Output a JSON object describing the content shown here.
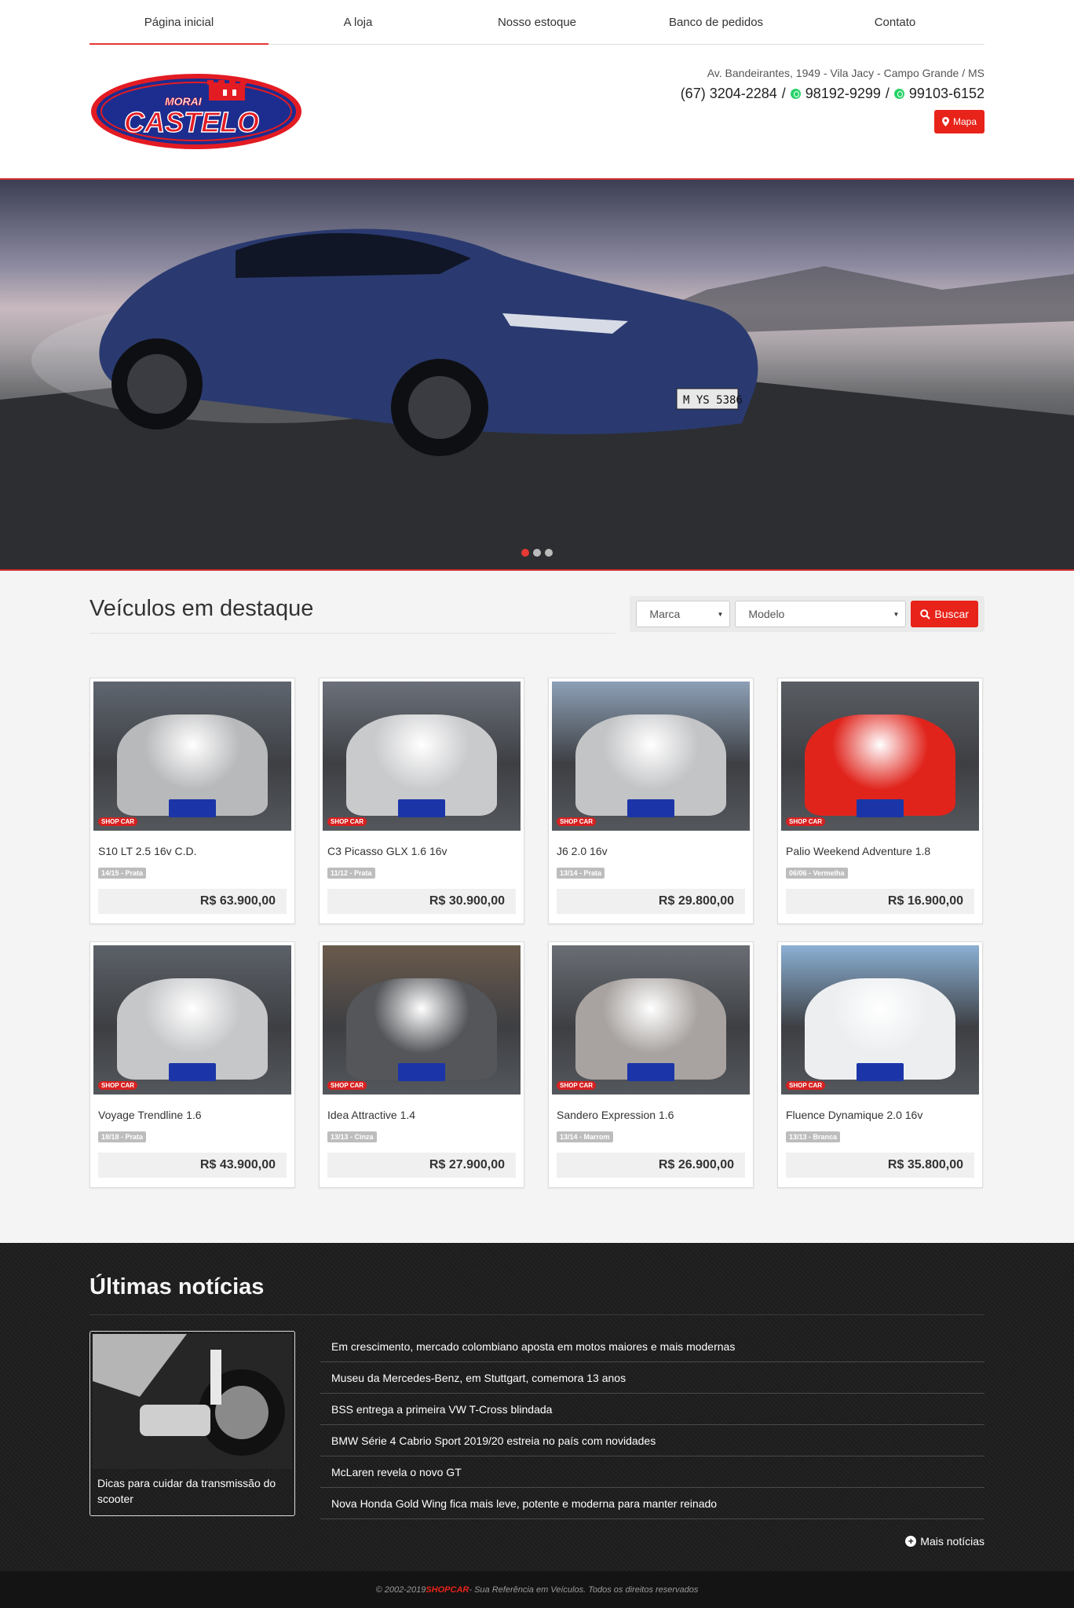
{
  "nav": {
    "items": [
      {
        "label": "Página inicial",
        "active": true
      },
      {
        "label": "A loja"
      },
      {
        "label": "Nosso estoque"
      },
      {
        "label": "Banco de pedidos"
      },
      {
        "label": "Contato"
      }
    ]
  },
  "header": {
    "logo_icon": "morai-castelo-logo",
    "logo_line1": "MORAI",
    "logo_line2": "CASTELO",
    "address": "Av. Bandeirantes, 1949 - Vila Jacy - Campo Grande / MS",
    "phone1": "(67) 3204-2284",
    "separator": "/",
    "phone2": "98192-9299",
    "phone3": "99103-6152",
    "map_label": "Mapa",
    "map_icon": "map-marker-icon",
    "whatsapp_icon": "whatsapp-icon"
  },
  "hero": {
    "plate": "M YS 5386",
    "slides_total": 3,
    "active_slide": 1
  },
  "featured": {
    "title": "Veículos em destaque",
    "marca_placeholder": "Marca",
    "modelo_placeholder": "Modelo",
    "search_label": "Buscar",
    "vehicles": [
      {
        "name": "S10 LT 2.5 16v C.D.",
        "tag": "14/15 - Prata",
        "price": "R$ 63.900,00",
        "body": "#b8b9bb",
        "bg": "#5f6670"
      },
      {
        "name": "C3 Picasso GLX 1.6 16v",
        "tag": "11/12 - Prata",
        "price": "R$ 30.900,00",
        "body": "#c9cacc",
        "bg": "#6b707a"
      },
      {
        "name": "J6 2.0 16v",
        "tag": "13/14 - Prata",
        "price": "R$ 29.800,00",
        "body": "#c3c4c6",
        "bg": "#8da0b6"
      },
      {
        "name": "Palio Weekend Adventure 1.8",
        "tag": "06/06 - Vermelha",
        "price": "R$ 16.900,00",
        "body": "#e0241c",
        "bg": "#5a5d63"
      },
      {
        "name": "Voyage Trendline 1.6",
        "tag": "18/18 - Prata",
        "price": "R$ 43.900,00",
        "body": "#c6c7c9",
        "bg": "#5c6168"
      },
      {
        "name": "Idea Attractive 1.4",
        "tag": "13/13 - Cinza",
        "price": "R$ 27.900,00",
        "body": "#54565a",
        "bg": "#6a5a4c"
      },
      {
        "name": "Sandero Expression 1.6",
        "tag": "13/14 - Marrom",
        "price": "R$ 26.900,00",
        "body": "#a8a3a0",
        "bg": "#6a6e74"
      },
      {
        "name": "Fluence Dynamique 2.0 16v",
        "tag": "13/13 - Branca",
        "price": "R$ 35.800,00",
        "body": "#eceef0",
        "bg": "#8cb0d4"
      }
    ],
    "shop_badge": "SHOP CAR"
  },
  "news": {
    "title": "Últimas notícias",
    "featured_caption": "Dicas para cuidar da transmissão do scooter",
    "items": [
      "Em crescimento, mercado colombiano aposta em motos maiores e mais modernas",
      "Museu da Mercedes-Benz, em Stuttgart, comemora 13 anos",
      "BSS entrega a primeira VW T-Cross blindada",
      "BMW Série 4 Cabrio Sport 2019/20 estreia no país com novidades",
      "McLaren revela o novo GT",
      "Nova Honda Gold Wing fica mais leve, potente e moderna para manter reinado"
    ],
    "more_label": "Mais notícias"
  },
  "footer": {
    "prefix": "© 2002-2019 ",
    "brand": "SHOPCAR",
    "suffix": " - Sua Referência em Veículos. Todos os direitos reservados"
  }
}
